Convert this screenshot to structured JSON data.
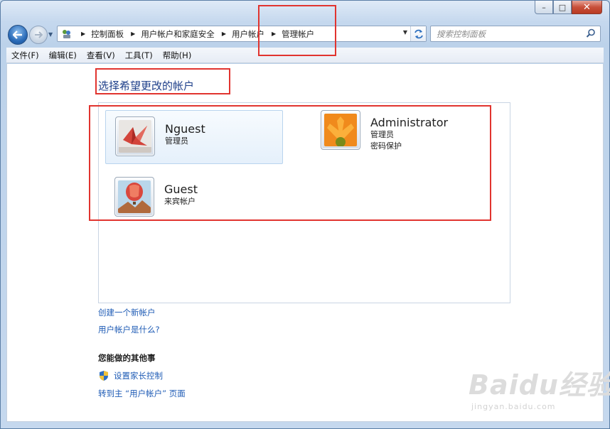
{
  "window": {
    "caption_buttons": {
      "minimize": "–",
      "maximize": "□",
      "close": "✕"
    }
  },
  "address_bar": {
    "breadcrumbs": [
      "控制面板",
      "用户帐户和家庭安全",
      "用户帐户",
      "管理帐户"
    ]
  },
  "search": {
    "placeholder": "搜索控制面板"
  },
  "menu": {
    "items": [
      "文件(F)",
      "编辑(E)",
      "查看(V)",
      "工具(T)",
      "帮助(H)"
    ]
  },
  "main": {
    "heading": "选择希望更改的帐户",
    "accounts": [
      {
        "name": "Nguest",
        "lines": [
          "管理员"
        ],
        "selected": true,
        "picture": "paper-crane"
      },
      {
        "name": "Administrator",
        "lines": [
          "管理员",
          "密码保护"
        ],
        "selected": false,
        "picture": "orange-flower"
      },
      {
        "name": "Guest",
        "lines": [
          "来宾帐户"
        ],
        "selected": false,
        "picture": "hot-air-balloon"
      }
    ],
    "links": {
      "create_account": "创建一个新帐户",
      "what_is_account": "用户帐户是什么?"
    },
    "other_section": {
      "title": "您能做的其他事",
      "parental_controls": "设置家长控制",
      "goto_main": "转到主 “用户帐户” 页面"
    }
  },
  "watermark": {
    "brand": "Baidu经验",
    "url": "jingyan.baidu.com"
  },
  "colors": {
    "link": "#1e5bb5",
    "heading": "#1e3f8a",
    "annotation": "#e1342f"
  }
}
